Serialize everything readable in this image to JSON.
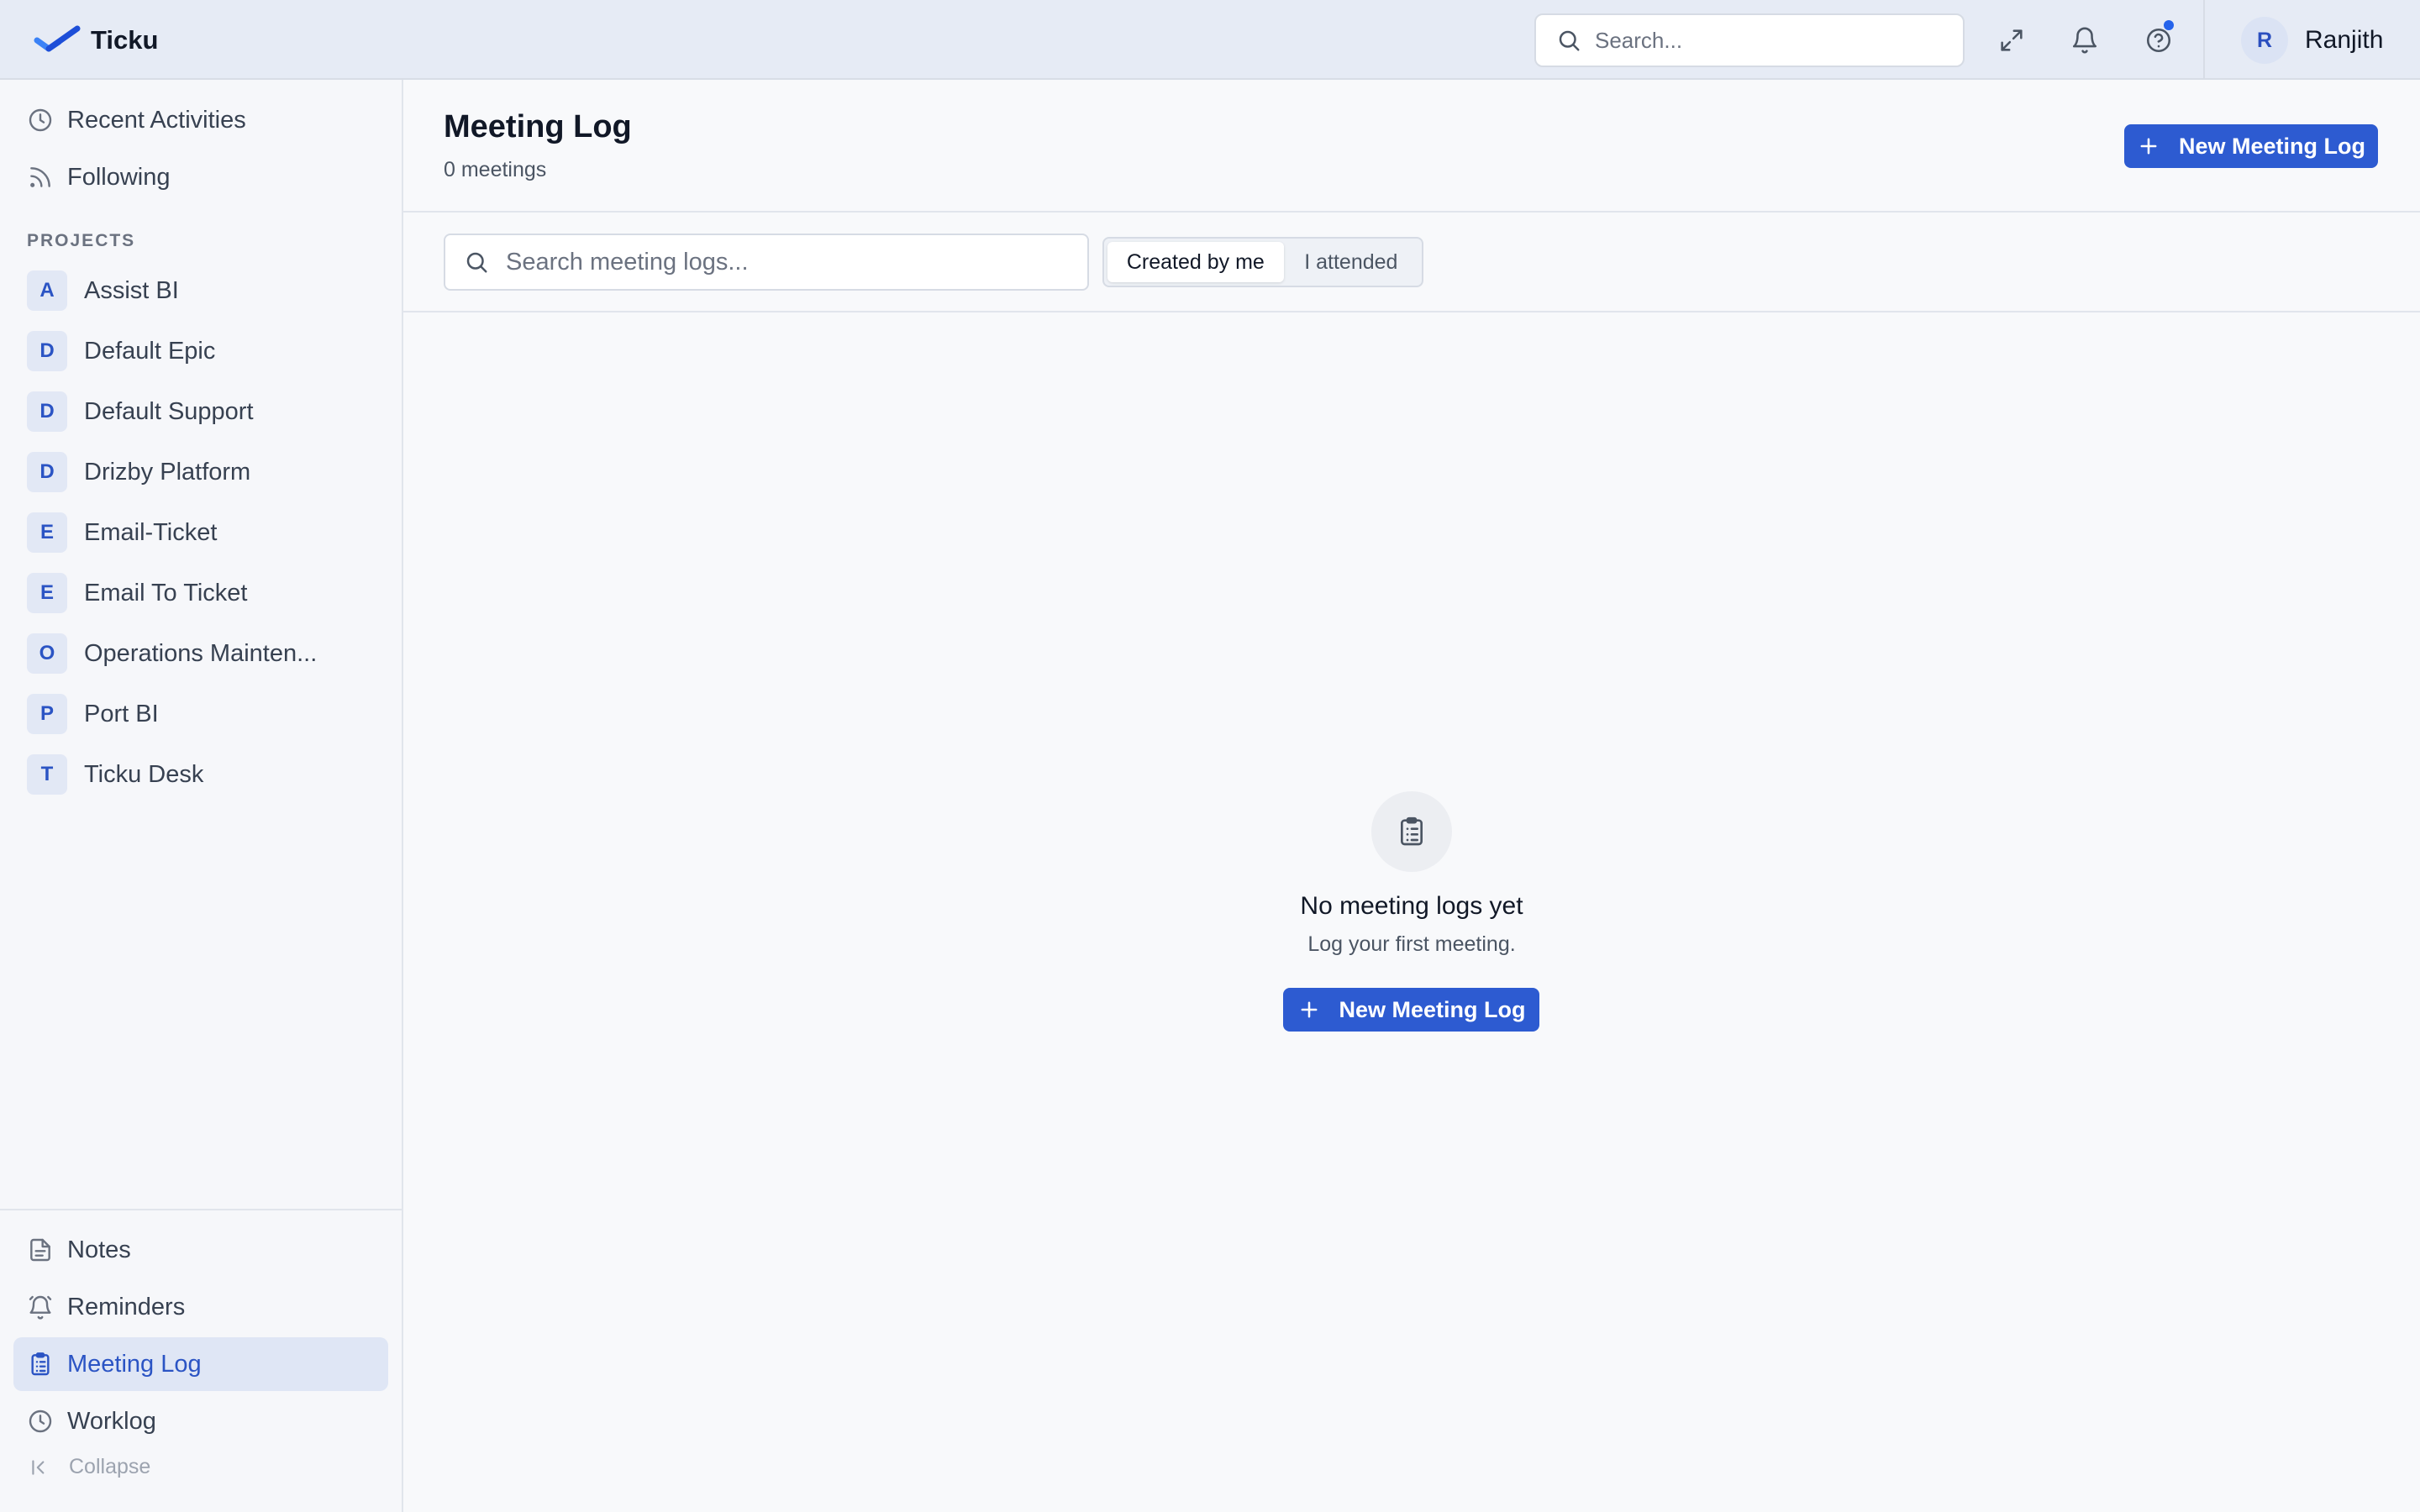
{
  "app": {
    "name": "Ticku",
    "accent": "#2d5bd1"
  },
  "topbar": {
    "search_placeholder": "Search...",
    "icons": [
      "search-icon",
      "expand-icon",
      "bell-icon",
      "help-icon"
    ],
    "user": {
      "initial": "R",
      "name": "Ranjith"
    }
  },
  "sidebar": {
    "top_items": [
      {
        "label": "Recent Activities",
        "icon": "clock-icon"
      },
      {
        "label": "Following",
        "icon": "rss-icon"
      }
    ],
    "projects_label": "PROJECTS",
    "projects": [
      {
        "initial": "A",
        "name": "Assist BI"
      },
      {
        "initial": "D",
        "name": "Default Epic"
      },
      {
        "initial": "D",
        "name": "Default Support"
      },
      {
        "initial": "D",
        "name": "Drizby Platform"
      },
      {
        "initial": "E",
        "name": "Email-Ticket"
      },
      {
        "initial": "E",
        "name": "Email To Ticket"
      },
      {
        "initial": "O",
        "name": "Operations Mainten..."
      },
      {
        "initial": "P",
        "name": "Port BI"
      },
      {
        "initial": "T",
        "name": "Ticku Desk"
      }
    ],
    "bottom_items": [
      {
        "label": "Notes",
        "icon": "file-text-icon"
      },
      {
        "label": "Reminders",
        "icon": "alarm-icon"
      },
      {
        "label": "Meeting Log",
        "icon": "clipboard-list-icon",
        "active": true
      },
      {
        "label": "Worklog",
        "icon": "clock-icon"
      }
    ],
    "collapse_label": "Collapse"
  },
  "main": {
    "title": "Meeting Log",
    "subtitle": "0 meetings",
    "new_button_label": "New Meeting Log",
    "search_placeholder": "Search meeting logs...",
    "filters": [
      {
        "label": "Created by me",
        "active": true
      },
      {
        "label": "I attended",
        "active": false
      }
    ],
    "empty_state": {
      "title": "No meeting logs yet",
      "subtitle": "Log your first meeting.",
      "button_label": "New Meeting Log"
    }
  }
}
